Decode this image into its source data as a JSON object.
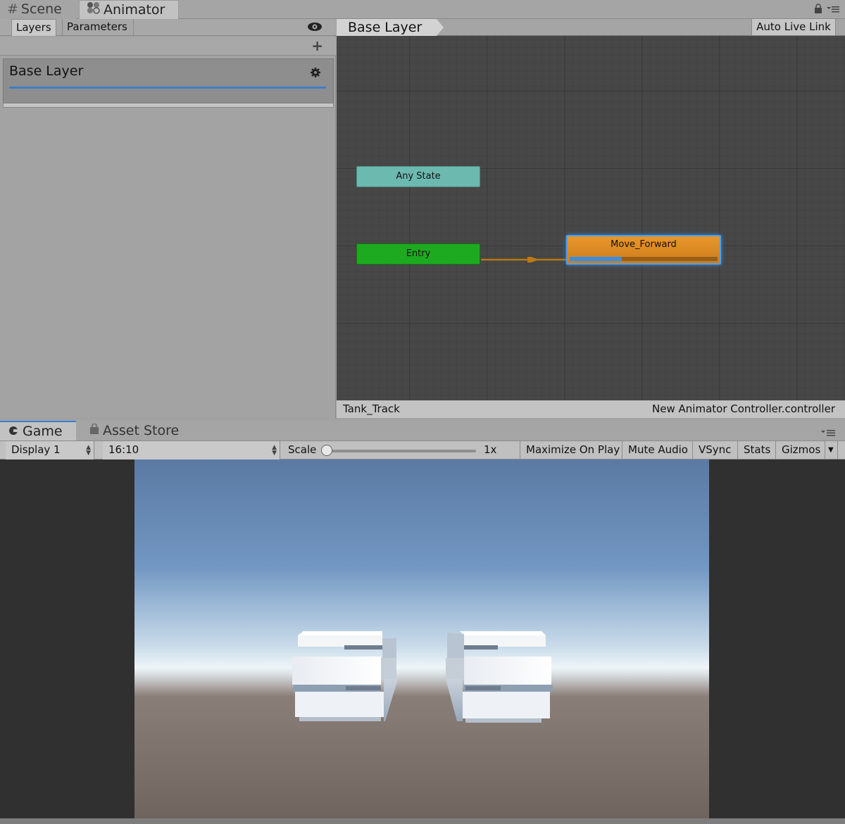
{
  "window": {
    "tabs": [
      {
        "label": "Scene",
        "icon": "grid-icon"
      },
      {
        "label": "Animator",
        "icon": "animator-icon",
        "active": true
      }
    ]
  },
  "animator": {
    "subtabs": [
      "Layers",
      "Parameters"
    ],
    "layers": [
      {
        "name": "Base Layer"
      }
    ],
    "breadcrumb": "Base Layer",
    "auto_live_link": "Auto Live Link",
    "nodes": {
      "any_state": "Any State",
      "entry": "Entry",
      "move_forward": "Move_Forward"
    },
    "move_forward_progress": 0.35,
    "footer_left": "Tank_Track",
    "footer_right": "New Animator Controller.controller",
    "colors": {
      "any_state": "#6cb9b0",
      "entry": "#1eaa20",
      "default_state": "#e08a26",
      "selection": "#3b8fe3",
      "transition": "#c07a14"
    }
  },
  "game": {
    "tabs": [
      {
        "label": "Game",
        "icon": "game-icon",
        "active": true
      },
      {
        "label": "Asset Store",
        "icon": "store-icon"
      }
    ],
    "toolbar": {
      "display": "Display 1",
      "aspect": "16:10",
      "scale_label": "Scale",
      "scale_value": "1x",
      "scale_fraction": 0.0,
      "maximize_on_play": "Maximize On Play",
      "mute_audio": "Mute Audio",
      "vsync": "VSync",
      "stats": "Stats",
      "gizmos": "Gizmos"
    }
  }
}
